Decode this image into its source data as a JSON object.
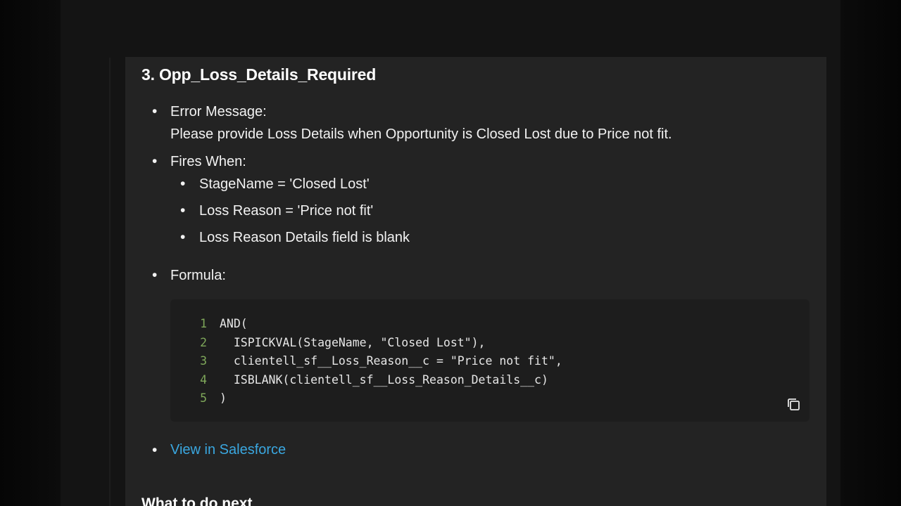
{
  "section": {
    "heading": "3. Opp_Loss_Details_Required",
    "error_message_label": "Error Message:",
    "error_message_text": "Please provide Loss Details when Opportunity is Closed Lost due to Price not fit.",
    "fires_when_label": "Fires When:",
    "conditions": [
      "StageName = 'Closed Lost'",
      "Loss Reason = 'Price not fit'",
      "Loss Reason Details field is blank"
    ],
    "formula_label": "Formula:",
    "code_lines": [
      {
        "number": "1",
        "code": "AND("
      },
      {
        "number": "2",
        "code": "  ISPICKVAL(StageName, \"Closed Lost\"),"
      },
      {
        "number": "3",
        "code": "  clientell_sf__Loss_Reason__c = \"Price not fit\","
      },
      {
        "number": "4",
        "code": "  ISBLANK(clientell_sf__Loss_Reason_Details__c)"
      },
      {
        "number": "5",
        "code": ")"
      }
    ],
    "link_text": "View in Salesforce",
    "next_heading": "What to do next"
  },
  "icons": {
    "copy": "copy-icon"
  },
  "colors": {
    "link": "#3aa7e0",
    "line_numbers": "#7fa85a",
    "panel_background": "#232323",
    "code_background": "#1d1d1d"
  }
}
